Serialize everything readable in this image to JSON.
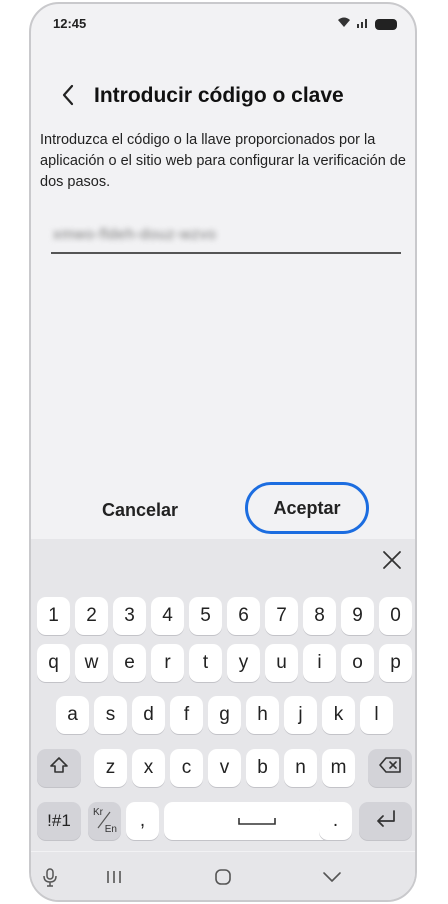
{
  "status_bar": {
    "time": "12:45"
  },
  "header": {
    "title": "Introducir código o clave"
  },
  "description": "Introduzca el código o la llave proporcionados por la aplicación o el sitio web para configurar la verificación de dos pasos.",
  "code_field": {
    "value": "xmwo-fldeh-douz-wzvo"
  },
  "dialog": {
    "cancel_label": "Cancelar",
    "accept_label": "Aceptar",
    "accept_color": "#1c6de0"
  },
  "keyboard": {
    "numbers": [
      "1",
      "2",
      "3",
      "4",
      "5",
      "6",
      "7",
      "8",
      "9",
      "0"
    ],
    "row1": [
      "q",
      "w",
      "e",
      "r",
      "t",
      "y",
      "u",
      "i",
      "o",
      "p"
    ],
    "row2": [
      "a",
      "s",
      "d",
      "f",
      "g",
      "h",
      "j",
      "k",
      "l"
    ],
    "row3": [
      "z",
      "x",
      "c",
      "v",
      "b",
      "n",
      "m"
    ],
    "symbols_label": "!#1",
    "lang_top": "Kr",
    "lang_bottom": "En",
    "comma": ",",
    "period": "."
  }
}
